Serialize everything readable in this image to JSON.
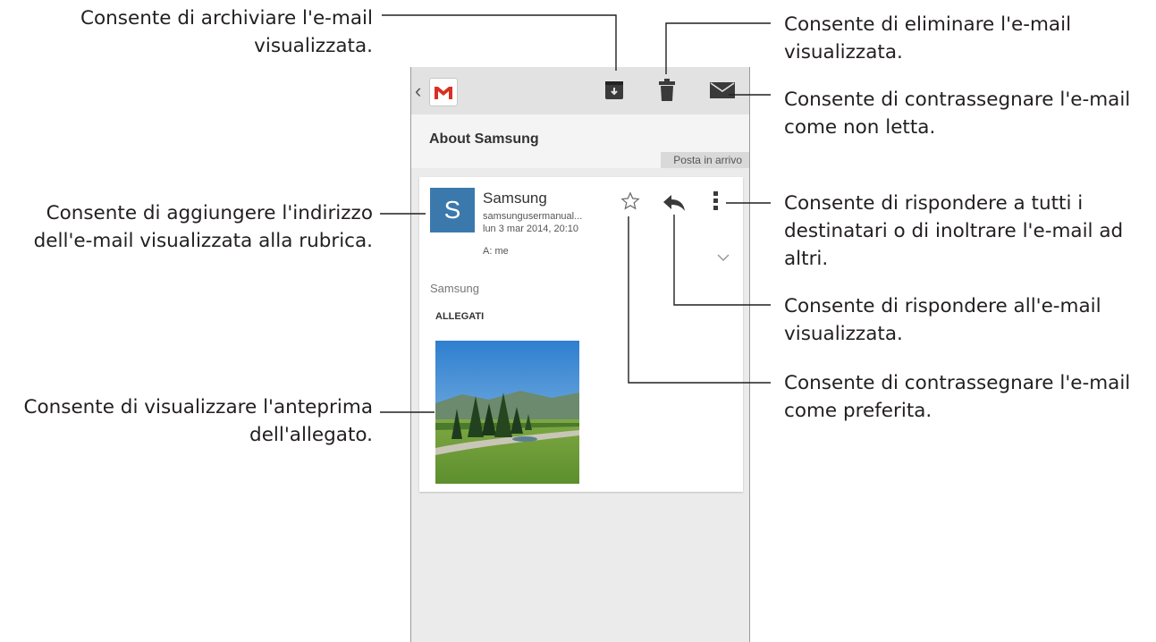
{
  "annotations": {
    "archive": "Consente di archiviare l'e-mail\nvisualizzata.",
    "delete": "Consente di eliminare l'e-mail\nvisualizzata.",
    "mark_unread": "Consente di contrassegnare l'e-mail\ncome non letta.",
    "add_contact": "Consente di aggiungere l'indirizzo\ndell'e-mail visualizzata alla rubrica.",
    "reply_all_forward": "Consente di rispondere a tutti i\ndestinatari o di inoltrare l'e-mail ad\naltri.",
    "reply": "Consente di rispondere all'e-mail\nvisualizzata.",
    "favorite": "Consente di contrassegnare l'e-mail\ncome preferita.",
    "preview": "Consente di visualizzare l'anteprima\ndell'allegato."
  },
  "app": {
    "back_glyph": "‹",
    "logo_icon": "gmail-logo-icon",
    "toolbar_icons": [
      "archive-icon",
      "delete-icon",
      "mark-unread-icon"
    ]
  },
  "email": {
    "subject": "About Samsung",
    "folder": "Posta in arrivo",
    "avatar_letter": "S",
    "avatar_color": "#3b79ad",
    "sender": "Samsung",
    "sender_email": "samsungusermanual...",
    "date": "lun 3 mar 2014, 20:10",
    "recipient": "A: me",
    "body": "Samsung",
    "attachments_heading": "ALLEGATI",
    "attachment_icons": [
      "star-icon",
      "reply-icon",
      "overflow-menu-icon",
      "chevron-down-icon"
    ]
  }
}
